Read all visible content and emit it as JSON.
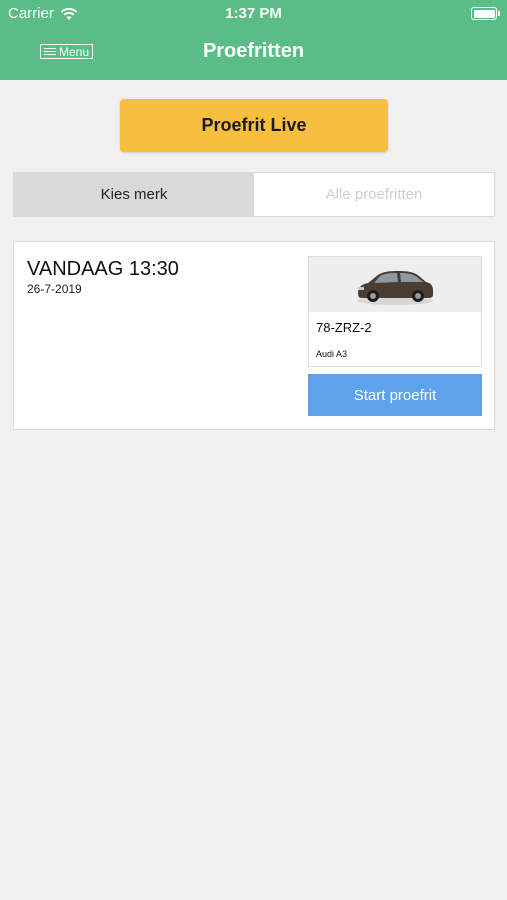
{
  "status_bar": {
    "carrier": "Carrier",
    "time": "1:37 PM",
    "wifi_icon": "wifi-icon",
    "battery_icon": "battery-icon"
  },
  "header": {
    "menu_label": "Menu",
    "menu_icon": "hamburger-icon",
    "title": "Proefritten",
    "color": "#5bbd86"
  },
  "live_button": {
    "label": "Proefrit Live",
    "color": "#f8bf3f"
  },
  "segmented": {
    "tabs": [
      {
        "label": "Kies merk",
        "selected": true
      },
      {
        "label": "Alle proefritten",
        "selected": false
      }
    ]
  },
  "appointment": {
    "time": "VANDAAG 13:30",
    "date": "26-7-2019",
    "car": {
      "image_icon": "car-photo",
      "plate": "78-ZRZ-2",
      "model": "Audi A3"
    },
    "start_label": "Start proefrit",
    "start_color": "#5da2ea"
  }
}
